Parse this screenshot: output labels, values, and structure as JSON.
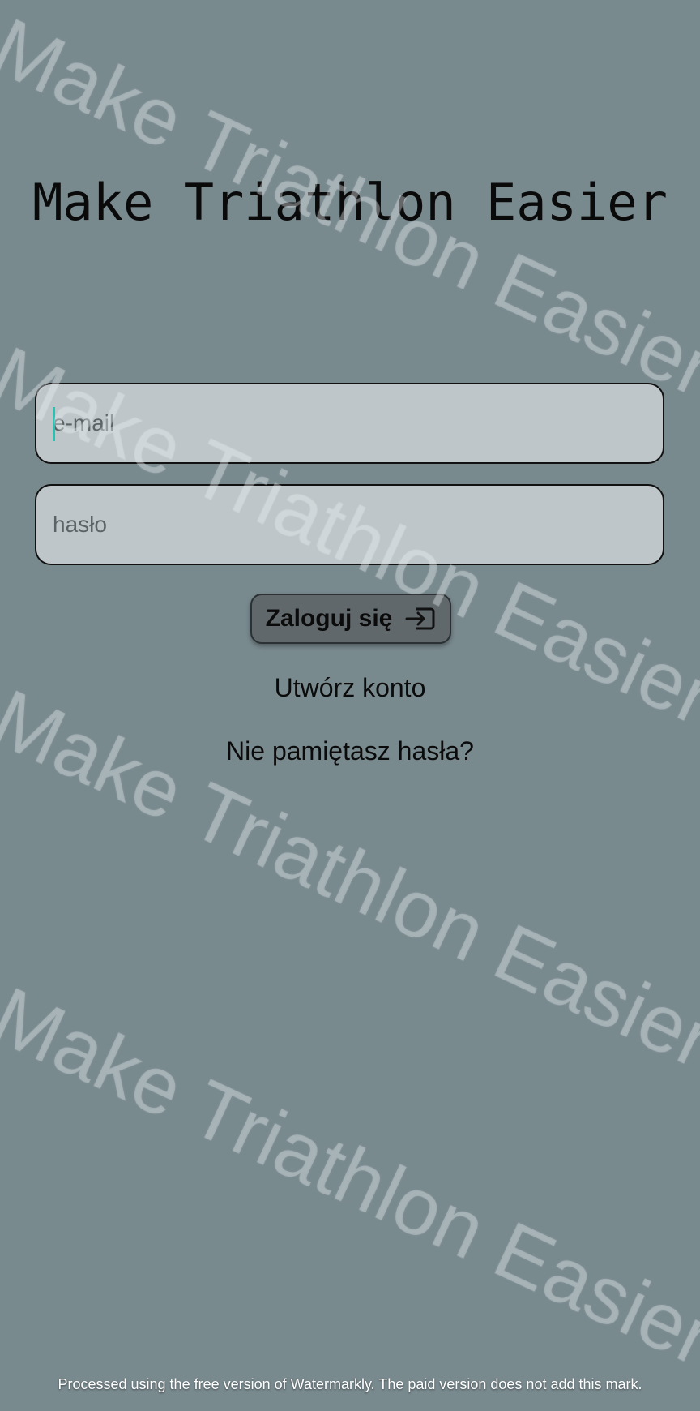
{
  "app": {
    "title": "Make Triathlon Easier"
  },
  "form": {
    "email_placeholder": "e-mail",
    "email_value": "",
    "password_placeholder": "hasło",
    "password_value": "",
    "login_label": "Zaloguj się",
    "login_icon": "login-icon",
    "create_account_label": "Utwórz konto",
    "forgot_password_label": "Nie pamiętasz hasła?"
  },
  "watermark": {
    "text": "Make Triathlon Easier",
    "footer": "Processed using the free version of Watermarkly. The paid version does not add this mark."
  },
  "colors": {
    "background": "#798a8f",
    "field_fill": "#bec6c9",
    "button_fill": "#60686c",
    "caret": "#1fc6b3"
  }
}
